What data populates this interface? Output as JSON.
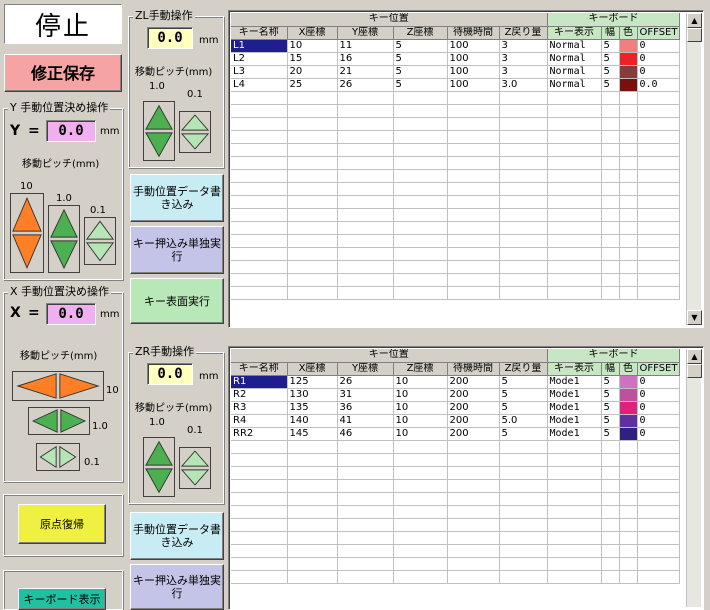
{
  "status": {
    "label": "停止"
  },
  "save_button": {
    "label": "修正保存"
  },
  "y_panel": {
    "title": "Y 手動位置決め操作",
    "axis": "Y",
    "eq": "=",
    "value": "0.0",
    "unit": "mm",
    "pitch_label": "移動ピッチ(mm)",
    "p10": "10",
    "p1": "1.0",
    "p01": "0.1"
  },
  "x_panel": {
    "title": "X 手動位置決め操作",
    "axis": "X",
    "eq": "=",
    "value": "0.0",
    "unit": "mm",
    "pitch_label": "移動ピッチ(mm)",
    "p10": "10",
    "p1": "1.0",
    "p01": "0.1"
  },
  "origin_button": {
    "label": "原点復帰"
  },
  "keyboard_button": {
    "label": "キーボード表示"
  },
  "zl_panel": {
    "title": "ZL手動操作",
    "value": "0.0",
    "unit": "mm",
    "pitch_label": "移動ピッチ(mm)",
    "p1": "1.0",
    "p01": "0.1",
    "write_button": "手動位置データ書き込み",
    "single_button": "キー押込み単独実行",
    "surface_button": "キー表面実行"
  },
  "zr_panel": {
    "title": "ZR手動操作",
    "value": "0.0",
    "unit": "mm",
    "pitch_label": "移動ピッチ(mm)",
    "p1": "1.0",
    "p01": "0.1",
    "write_button": "手動位置データ書き込み",
    "single_button": "キー押込み単独実行"
  },
  "table_headers": {
    "group_position": "キー位置",
    "group_keyboard": "キーボード",
    "cols": [
      "キー名称",
      "X座標",
      "Y座標",
      "Z座標",
      "待機時間",
      "Z戻り量",
      "キー表示",
      "幅",
      "色",
      "OFFSET"
    ]
  },
  "zl_table": {
    "rows": [
      {
        "name": "L1",
        "x": "10",
        "y": "11",
        "z": "5",
        "wait": "100",
        "zret": "3",
        "disp": "Normal",
        "width": "5",
        "color": "#f08080",
        "offset": "0"
      },
      {
        "name": "L2",
        "x": "15",
        "y": "16",
        "z": "5",
        "wait": "100",
        "zret": "3",
        "disp": "Normal",
        "width": "5",
        "color": "#ee2222",
        "offset": "0"
      },
      {
        "name": "L3",
        "x": "20",
        "y": "21",
        "z": "5",
        "wait": "100",
        "zret": "3",
        "disp": "Normal",
        "width": "5",
        "color": "#8b3a3a",
        "offset": "0"
      },
      {
        "name": "L4",
        "x": "25",
        "y": "26",
        "z": "5",
        "wait": "100",
        "zret": "3.0",
        "disp": "Normal",
        "width": "5",
        "color": "#7a0f0f",
        "offset": "0.0"
      }
    ]
  },
  "zr_table": {
    "rows": [
      {
        "name": "R1",
        "x": "125",
        "y": "26",
        "z": "10",
        "wait": "200",
        "zret": "5",
        "disp": "Mode1",
        "width": "5",
        "color": "#d070c0",
        "offset": "0"
      },
      {
        "name": "R2",
        "x": "130",
        "y": "31",
        "z": "10",
        "wait": "200",
        "zret": "5",
        "disp": "Mode1",
        "width": "5",
        "color": "#c0509c",
        "offset": "0"
      },
      {
        "name": "R3",
        "x": "135",
        "y": "36",
        "z": "10",
        "wait": "200",
        "zret": "5",
        "disp": "Mode1",
        "width": "5",
        "color": "#e02080",
        "offset": "0"
      },
      {
        "name": "R4",
        "x": "140",
        "y": "41",
        "z": "10",
        "wait": "200",
        "zret": "5.0",
        "disp": "Mode1",
        "width": "5",
        "color": "#6030a0",
        "offset": "0"
      },
      {
        "name": "RR2",
        "x": "145",
        "y": "46",
        "z": "10",
        "wait": "200",
        "zret": "5",
        "disp": "Mode1",
        "width": "5",
        "color": "#302080",
        "offset": "0"
      }
    ]
  }
}
